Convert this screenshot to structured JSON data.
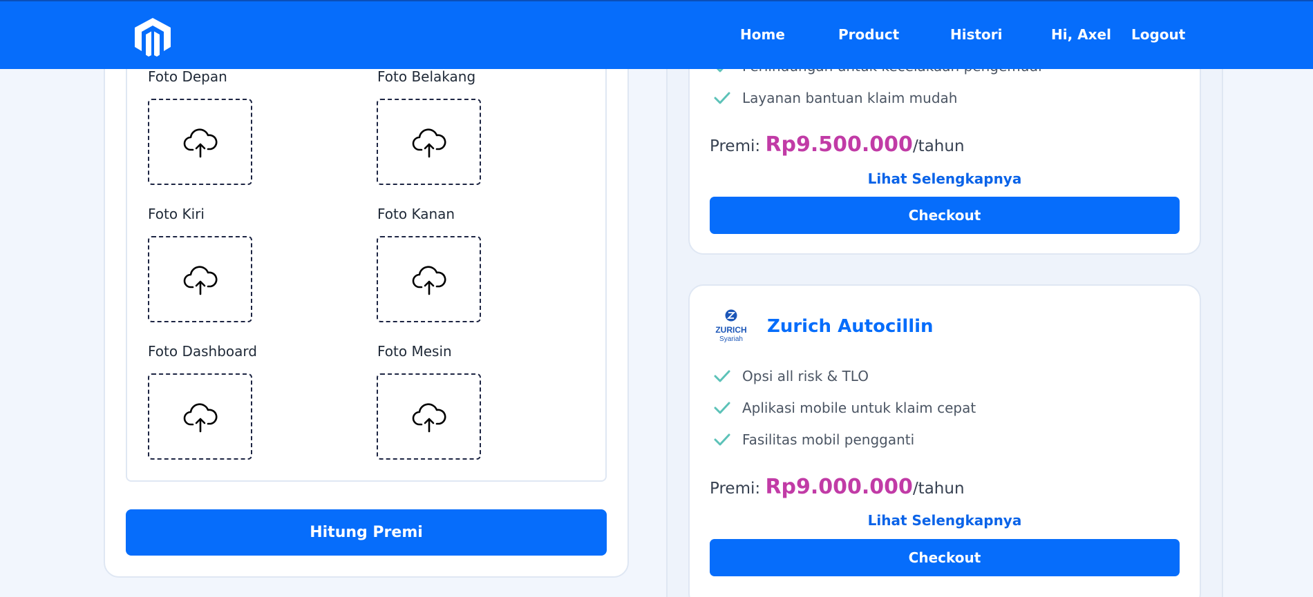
{
  "navbar": {
    "links": [
      "Home",
      "Product",
      "Histori",
      "Hi, Axel",
      "Logout"
    ]
  },
  "upload": {
    "items": [
      "Foto Depan",
      "Foto Belakang",
      "Foto Kiri",
      "Foto Kanan",
      "Foto Dashboard",
      "Foto Mesin"
    ]
  },
  "actions": {
    "hitung_label": "Hitung Premi"
  },
  "product1": {
    "features": [
      "Perlindungan untuk kecelakaan pengemudi",
      "Layanan bantuan klaim mudah"
    ],
    "premi_label": "Premi:",
    "price": "Rp9.500.000",
    "period": "/tahun",
    "more_label": "Lihat Selengkapnya",
    "checkout_label": "Checkout"
  },
  "product2": {
    "logo_text": "ZURICH",
    "logo_sub": "Syariah",
    "title": "Zurich Autocillin",
    "features": [
      "Opsi all risk & TLO",
      "Aplikasi mobile untuk klaim cepat",
      "Fasilitas mobil pengganti"
    ],
    "premi_label": "Premi:",
    "price": "Rp9.000.000",
    "period": "/tahun",
    "more_label": "Lihat Selengkapnya",
    "checkout_label": "Checkout"
  },
  "colors": {
    "primary": "#066dfb",
    "price": "#c13ba6",
    "check": "#5cc2b8",
    "background": "#f2f6fd"
  }
}
